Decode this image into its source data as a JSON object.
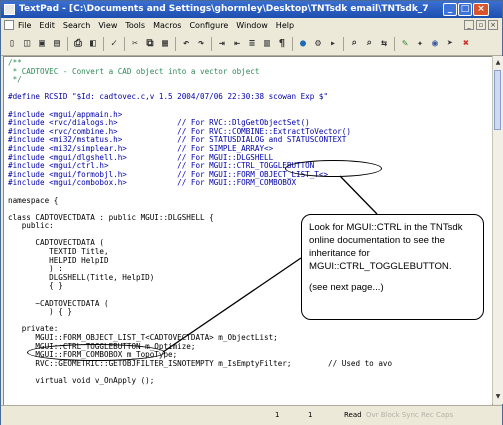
{
  "window": {
    "title": "TextPad - [C:\\Documents and Settings\\ghormley\\Desktop\\TNTsdk email\\TNTsdk_70_Win32_20040..."
  },
  "menu": [
    "File",
    "Edit",
    "Search",
    "View",
    "Tools",
    "Macros",
    "Configure",
    "Window",
    "Help"
  ],
  "code_lines": [
    {
      "cls": "cm",
      "text": "/**"
    },
    {
      "cls": "cm",
      "text": " * CADTOVEC - Convert a CAD object into a vector object"
    },
    {
      "cls": "cm",
      "text": " */"
    },
    {
      "cls": "",
      "text": ""
    },
    {
      "cls": "pp",
      "text": "#define RCSID \"$Id: cadtovec.c,v 1.5 2004/07/06 22:30:38 scowan Exp $\""
    },
    {
      "cls": "",
      "text": ""
    },
    {
      "cls": "pp",
      "text": "#include <mgui/appmain.h>"
    },
    {
      "cls": "pp",
      "text": "#include <rvc/dialogs.h>             // For RVC::DlgGetObjectSet()"
    },
    {
      "cls": "pp",
      "text": "#include <rvc/combine.h>             // For RVC::COMBINE::ExtractToVector()"
    },
    {
      "cls": "pp",
      "text": "#include <mi32/mstatus.h>            // For STATUSDIALOG and STATUSCONTEXT"
    },
    {
      "cls": "pp",
      "text": "#include <mi32/simplear.h>           // For SIMPLE_ARRAY<>"
    },
    {
      "cls": "pp",
      "text": "#include <mgui/dlgshell.h>           // For MGUI::DLGSHELL"
    },
    {
      "cls": "pp",
      "text": "#include <mgui/ctrl.h>               // For MGUI::CTRL_TOGGLEBUTTON"
    },
    {
      "cls": "pp",
      "text": "#include <mgui/formobjl.h>           // For MGUI::FORM_OBJECT_LIST_T<>"
    },
    {
      "cls": "pp",
      "text": "#include <mgui/combobox.h>           // For MGUI::FORM_COMBOBOX"
    },
    {
      "cls": "",
      "text": ""
    },
    {
      "cls": "",
      "text": "namespace {"
    },
    {
      "cls": "",
      "text": ""
    },
    {
      "cls": "",
      "text": "class CADTOVECTDATA : public MGUI::DLGSHELL {"
    },
    {
      "cls": "",
      "text": "   public:"
    },
    {
      "cls": "",
      "text": ""
    },
    {
      "cls": "",
      "text": "      CADTOVECTDATA ("
    },
    {
      "cls": "",
      "text": "         TEXTID Title,"
    },
    {
      "cls": "",
      "text": "         HELPID HelpID"
    },
    {
      "cls": "",
      "text": "         ) :"
    },
    {
      "cls": "",
      "text": "         DLGSHELL(Title, HelpID)"
    },
    {
      "cls": "",
      "text": "         { }"
    },
    {
      "cls": "",
      "text": ""
    },
    {
      "cls": "",
      "text": "      ~CADTOVECTDATA ("
    },
    {
      "cls": "",
      "text": "         ) { }"
    },
    {
      "cls": "",
      "text": ""
    },
    {
      "cls": "",
      "text": "   private:"
    },
    {
      "cls": "",
      "text": "      MGUI::FORM_OBJECT_LIST_T<CADTOVECTDATA> m_ObjectList;"
    },
    {
      "cls": "",
      "text": "      MGUI::CTRL_TOGGLEBUTTON m_Optimize;"
    },
    {
      "cls": "",
      "text": "      MGUI::FORM_COMBOBOX m_TopoType;"
    },
    {
      "cls": "",
      "text": "      RVC::GEOMETRIC::GETOBJFILTER_ISNOTEMPTY m_IsEmptyFilter;        // Used to avo"
    },
    {
      "cls": "",
      "text": ""
    },
    {
      "cls": "",
      "text": "      virtual void v_OnApply ();"
    }
  ],
  "callout": {
    "text": "Look for MGUI::CTRL in the TNTsdk online documentation to see the inheritance for MGUI::CTRL_TOGGLEBUTTON.",
    "sub": "(see next page...)"
  },
  "status": {
    "line": "1",
    "col": "1",
    "mode": "Read",
    "dim": "Ovr Block Sync Rec Caps"
  }
}
